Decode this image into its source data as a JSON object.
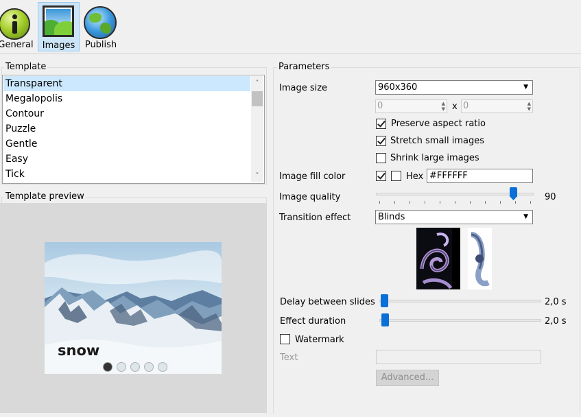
{
  "toolbar": {
    "items": [
      {
        "label": "General",
        "icon": "info-icon"
      },
      {
        "label": "Images",
        "icon": "image-icon",
        "active": true
      },
      {
        "label": "Publish",
        "icon": "globe-icon"
      }
    ]
  },
  "template": {
    "group_title": "Template",
    "items": [
      "Transparent",
      "Megalopolis",
      "Contour",
      "Puzzle",
      "Gentle",
      "Easy",
      "Tick"
    ],
    "selected": "Transparent"
  },
  "preview": {
    "group_title": "Template preview",
    "caption": "snow",
    "dots": 5,
    "active_dot": 1
  },
  "parameters": {
    "group_title": "Parameters",
    "image_size": {
      "label": "Image size",
      "value": "960x360"
    },
    "width_value": "0",
    "height_value": "0",
    "times": "x",
    "preserve_aspect": {
      "label": "Preserve aspect ratio",
      "checked": true
    },
    "stretch_small": {
      "label": "Stretch small images",
      "checked": true
    },
    "shrink_large": {
      "label": "Shrink large images",
      "checked": false
    },
    "fill_color": {
      "label": "Image fill color",
      "checked": true,
      "hex_label": "Hex",
      "hex_checked": false,
      "value": "#FFFFFF"
    },
    "quality": {
      "label": "Image quality",
      "value": "90",
      "fraction": 0.9
    },
    "transition": {
      "label": "Transition effect",
      "value": "Blinds"
    },
    "delay": {
      "label": "Delay between slides",
      "value": "2,0 s",
      "fraction": 0.0
    },
    "effect_duration": {
      "label": "Effect duration",
      "value": "2,0 s",
      "fraction": 0.0
    },
    "watermark": {
      "label": "Watermark",
      "checked": false
    },
    "text": {
      "label": "Text",
      "value": ""
    },
    "advanced_label": "Advanced..."
  },
  "colors": {
    "accent": "#0a6fd6",
    "selection": "#cce8ff"
  }
}
